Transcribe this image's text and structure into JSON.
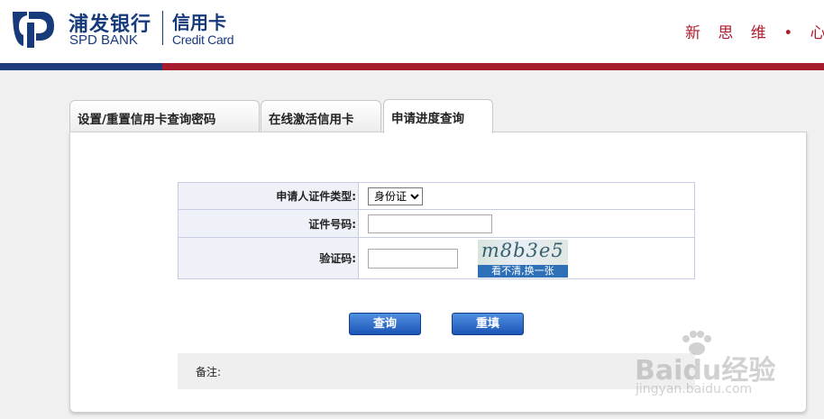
{
  "header": {
    "bank_name_cn": "浦发银行",
    "bank_name_en": "SPD BANK",
    "card_cn": "信用卡",
    "card_en": "Credit Card",
    "slogan": "新 思 维 • 心 服 务"
  },
  "colors": {
    "brand_blue": "#1d3e7b",
    "brand_red": "#a51d2d",
    "button_blue": "#1c55b7"
  },
  "tabs": [
    {
      "label": "设置/重置信用卡查询密码",
      "active": false
    },
    {
      "label": "在线激活信用卡",
      "active": false
    },
    {
      "label": "申请进度查询",
      "active": true
    }
  ],
  "form": {
    "id_type_label": "申请人证件类型:",
    "id_type_selected": "身份证",
    "id_number_label": "证件号码:",
    "id_number_value": "",
    "captcha_label": "验证码:",
    "captcha_value": "",
    "captcha_image_text": "m8b3e5",
    "captcha_refresh": "看不清,换一张"
  },
  "buttons": {
    "query": "查询",
    "reset": "重填"
  },
  "note": {
    "label": "备注:"
  },
  "watermark": {
    "main": "Baidu经验",
    "sub": "jingyan.baidu.com"
  }
}
